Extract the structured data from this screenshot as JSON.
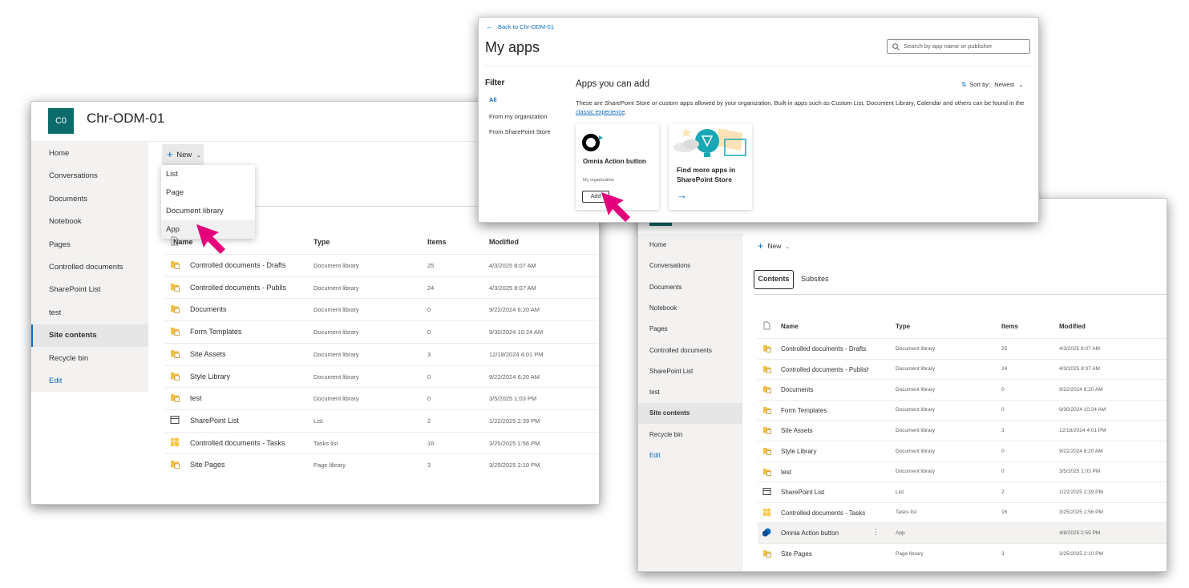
{
  "colors": {
    "accent": "#0f6cbd",
    "brand_teal": "#0b6a6a",
    "pointer_pink": "#e3007a"
  },
  "window_left": {
    "logo_text": "C0",
    "site_name": "Chr-ODM-01",
    "nav": [
      "Home",
      "Conversations",
      "Documents",
      "Notebook",
      "Pages",
      "Controlled documents",
      "SharePoint List",
      "test",
      "Site contents",
      "Recycle bin",
      "Edit"
    ],
    "selected_nav": "Site contents",
    "new_label": "New",
    "new_menu": [
      "List",
      "Page",
      "Document library",
      "App"
    ],
    "hovered_menu": "App",
    "columns": [
      "Name",
      "Type",
      "Items",
      "Modified"
    ],
    "rows": [
      {
        "name": "Controlled documents - Drafts",
        "type": "Document library",
        "items": "25",
        "modified": "4/3/2025 8:07 AM",
        "icon": "library-icon"
      },
      {
        "name": "Controlled documents - Published",
        "type": "Document library",
        "items": "24",
        "modified": "4/3/2025 8:07 AM",
        "icon": "library-icon"
      },
      {
        "name": "Documents",
        "type": "Document library",
        "items": "0",
        "modified": "9/22/2024 6:20 AM",
        "icon": "library-icon"
      },
      {
        "name": "Form Templates",
        "type": "Document library",
        "items": "0",
        "modified": "9/30/2024 10:24 AM",
        "icon": "library-icon"
      },
      {
        "name": "Site Assets",
        "type": "Document library",
        "items": "3",
        "modified": "12/18/2024 4:01 PM",
        "icon": "library-icon"
      },
      {
        "name": "Style Library",
        "type": "Document library",
        "items": "0",
        "modified": "9/22/2024 6:20 AM",
        "icon": "library-icon"
      },
      {
        "name": "test",
        "type": "Document library",
        "items": "0",
        "modified": "3/5/2025 1:03 PM",
        "icon": "library-icon"
      },
      {
        "name": "SharePoint List",
        "type": "List",
        "items": "2",
        "modified": "1/22/2025 2:39 PM",
        "icon": "list-icon"
      },
      {
        "name": "Controlled documents - Tasks",
        "type": "Tasks list",
        "items": "16",
        "modified": "3/25/2025 1:56 PM",
        "icon": "tasks-icon"
      },
      {
        "name": "Site Pages",
        "type": "Page library",
        "items": "3",
        "modified": "3/25/2025 2:10 PM",
        "icon": "library-icon"
      }
    ]
  },
  "window_apps": {
    "back_link": "Back to Chr-ODM-01",
    "title": "My apps",
    "search_placeholder": "Search by app name or publisher",
    "filter_heading": "Filter",
    "filters": [
      "All",
      "From my organization",
      "From SharePoint Store"
    ],
    "active_filter": "All",
    "section_heading": "Apps you can add",
    "sort_label": "Sort by:",
    "sort_value": "Newest",
    "description": "These are SharePoint Store or custom apps allowed by your organization. Built-in apps such as Custom List, Document Library, Calendar and others can be found in the",
    "description_link": "classic experience",
    "description_end": ".",
    "app_card": {
      "name": "Omnia Action button",
      "publisher": "My organization",
      "button": "Add"
    },
    "store_card": {
      "text": "Find more apps in SharePoint Store"
    }
  },
  "window_right": {
    "nav": [
      "Home",
      "Conversations",
      "Documents",
      "Notebook",
      "Pages",
      "Controlled documents",
      "SharePoint List",
      "test",
      "Site contents",
      "Recycle bin",
      "Edit"
    ],
    "selected_nav": "Site contents",
    "new_label": "New",
    "tabs": [
      "Contents",
      "Subsites"
    ],
    "active_tab": "Contents",
    "columns": [
      "Name",
      "Type",
      "Items",
      "Modified"
    ],
    "rows": [
      {
        "name": "Controlled documents - Drafts",
        "type": "Document library",
        "items": "25",
        "modified": "4/3/2025 8:07 AM",
        "icon": "library-icon"
      },
      {
        "name": "Controlled documents - Published",
        "type": "Document library",
        "items": "24",
        "modified": "4/3/2025 8:07 AM",
        "icon": "library-icon"
      },
      {
        "name": "Documents",
        "type": "Document library",
        "items": "0",
        "modified": "9/22/2024 6:20 AM",
        "icon": "library-icon"
      },
      {
        "name": "Form Templates",
        "type": "Document library",
        "items": "0",
        "modified": "9/30/2024 10:24 AM",
        "icon": "library-icon"
      },
      {
        "name": "Site Assets",
        "type": "Document library",
        "items": "3",
        "modified": "12/18/2024 4:01 PM",
        "icon": "library-icon"
      },
      {
        "name": "Style Library",
        "type": "Document library",
        "items": "0",
        "modified": "9/22/2024 6:20 AM",
        "icon": "library-icon"
      },
      {
        "name": "test",
        "type": "Document library",
        "items": "0",
        "modified": "3/5/2025 1:03 PM",
        "icon": "library-icon"
      },
      {
        "name": "SharePoint List",
        "type": "List",
        "items": "2",
        "modified": "1/22/2025 2:39 PM",
        "icon": "list-icon"
      },
      {
        "name": "Controlled documents - Tasks",
        "type": "Tasks list",
        "items": "16",
        "modified": "3/25/2025 1:56 PM",
        "icon": "tasks-icon"
      },
      {
        "name": "Omnia Action button",
        "type": "App",
        "items": "",
        "modified": "4/8/2025 2:55 PM",
        "icon": "app-icon",
        "highlighted": true
      },
      {
        "name": "Site Pages",
        "type": "Page library",
        "items": "3",
        "modified": "3/25/2025 2:10 PM",
        "icon": "library-icon"
      }
    ]
  }
}
